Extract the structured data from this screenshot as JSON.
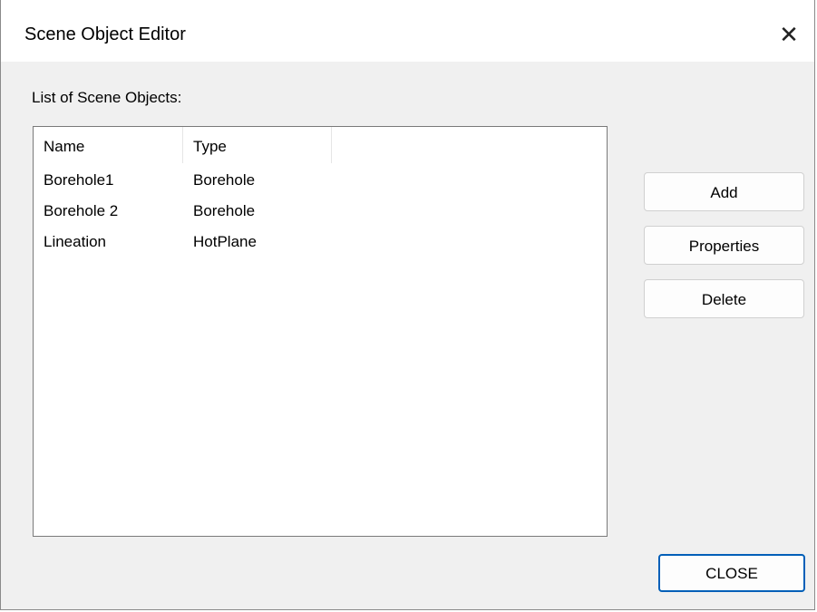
{
  "window": {
    "title": "Scene Object Editor",
    "close_glyph": "✕"
  },
  "list": {
    "caption": "List of Scene Objects:",
    "columns": [
      "Name",
      "Type"
    ],
    "rows": [
      {
        "name": "Borehole1",
        "type": "Borehole"
      },
      {
        "name": "Borehole 2",
        "type": "Borehole"
      },
      {
        "name": "Lineation",
        "type": "HotPlane"
      }
    ]
  },
  "buttons": {
    "add": "Add",
    "properties": "Properties",
    "delete": "Delete",
    "close": "CLOSE"
  },
  "colors": {
    "dialog_background": "#f0f0f0",
    "titlebar_background": "#ffffff",
    "default_button_border": "#005fb8"
  },
  "icons": {
    "close": "close-icon"
  }
}
